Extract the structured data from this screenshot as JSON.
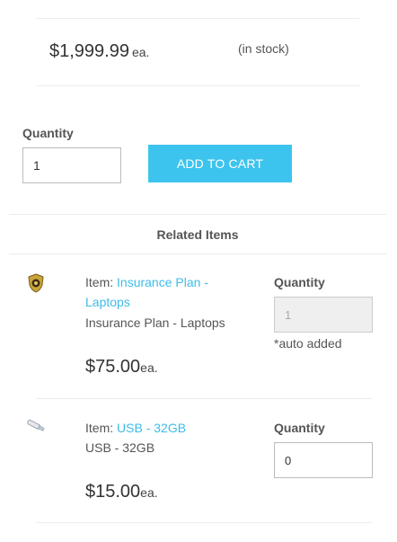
{
  "product": {
    "price": "$1,999.99",
    "price_unit": "ea.",
    "stock_status": "(in stock)"
  },
  "purchase": {
    "quantity_label": "Quantity",
    "quantity_value": "1",
    "add_to_cart_label": "ADD TO CART"
  },
  "related": {
    "title": "Related Items",
    "items": [
      {
        "item_prefix": "Item: ",
        "link_text": "Insurance Plan - Laptops",
        "description": "Insurance Plan - Laptops",
        "price": "$75.00",
        "price_unit": "ea.",
        "quantity_label": "Quantity",
        "quantity_value": "1",
        "note": "*auto added",
        "icon": "insurance-badge-icon"
      },
      {
        "item_prefix": "Item: ",
        "link_text": "USB - 32GB",
        "description": "USB - 32GB",
        "price": "$15.00",
        "price_unit": "ea.",
        "quantity_label": "Quantity",
        "quantity_value": "0",
        "icon": "usb-drive-icon"
      }
    ]
  },
  "colors": {
    "accent": "#3dc4ee",
    "link": "#3dbde8",
    "divider": "#ececec"
  }
}
